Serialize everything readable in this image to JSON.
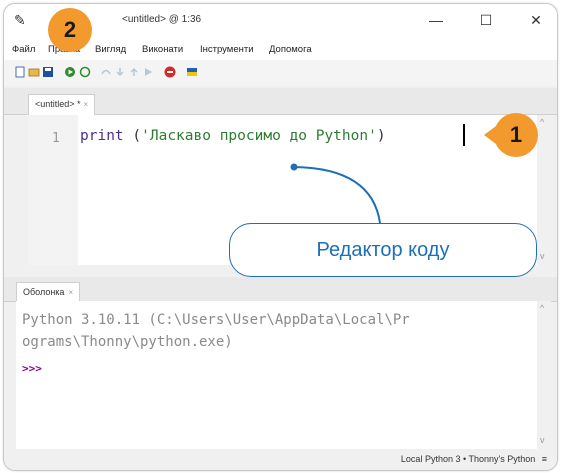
{
  "window": {
    "title": "<untitled> @ 1:36",
    "minimize_glyph": "—",
    "maximize_glyph": "☐",
    "close_glyph": "✕"
  },
  "menu": [
    {
      "label": "Файл"
    },
    {
      "label": "Правка"
    },
    {
      "label": "Вигляд"
    },
    {
      "label": "Виконати"
    },
    {
      "label": "Інструменти"
    },
    {
      "label": "Допомога"
    }
  ],
  "toolbar": {
    "icons": [
      "new-file-icon",
      "open-file-icon",
      "save-icon",
      "run-icon",
      "debug-icon",
      "step-over-icon",
      "step-into-icon",
      "step-out-icon",
      "resume-icon",
      "stop-icon",
      "flag-icon"
    ],
    "colors": {
      "run": "#2e8b2e",
      "stop": "#d62828",
      "flag_blue": "#1f5fbf",
      "flag_yellow": "#f5c400",
      "disabled": "#b9c6d6"
    }
  },
  "editor": {
    "tab_label": "<untitled> *",
    "tab_close": "×",
    "line_number": "1",
    "code": {
      "keyword": "print",
      "open": " (",
      "string": "'Ласкаво просимо до Python'",
      "close": ")"
    }
  },
  "shell": {
    "tab_label": "Оболонка",
    "tab_close": "×",
    "lines": [
      "Python 3.10.11 (C:\\Users\\User\\AppData\\Local\\Pr",
      "ograms\\Thonny\\python.exe)"
    ],
    "prompt": ">>>"
  },
  "status": {
    "text": "Local Python 3 • Thonny's Python",
    "menu_glyph": "≡"
  },
  "annotations": {
    "badge1": "1",
    "badge2": "2",
    "callout": "Редактор коду",
    "badge_color": "#f29a2e",
    "callout_color": "#1d6fb8"
  }
}
